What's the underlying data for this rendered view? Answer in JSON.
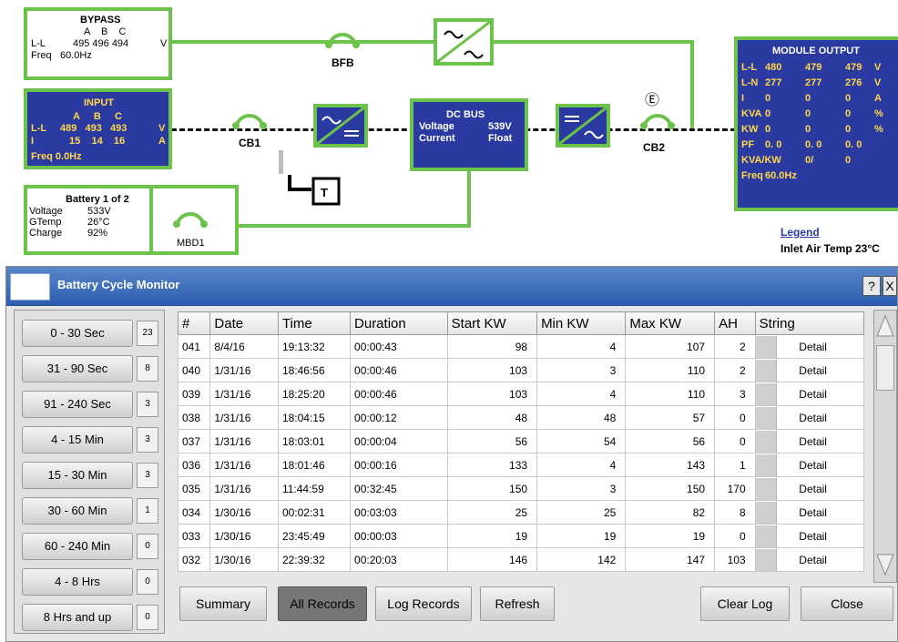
{
  "bypass": {
    "title": "BYPASS",
    "phases": "A    B    C",
    "ll_label": "L-L",
    "ll_values": "495 496 494",
    "ll_unit": "V",
    "freq_label": "Freq",
    "freq_value": "60.0Hz"
  },
  "input": {
    "title": "INPUT",
    "phases": "A     B     C",
    "ll_label": "L-L",
    "ll_values": "489   493   493",
    "ll_unit": "V",
    "i_label": "I",
    "i_values": "15    14    16",
    "i_unit": "A",
    "freq": "Freq 0.0Hz"
  },
  "battery": {
    "title": "Battery 1 of 2",
    "rows": [
      {
        "label": "Voltage",
        "value": "533V"
      },
      {
        "label": "GTemp",
        "value": "26°C"
      },
      {
        "label": "Charge",
        "value": "92%"
      }
    ]
  },
  "dc_bus": {
    "title": "DC BUS",
    "voltage_label": "Voltage",
    "voltage_value": "539V",
    "current_label": "Current",
    "current_value": "Float"
  },
  "breakers": {
    "bfb": "BFB",
    "cb1": "CB1",
    "cb2": "CB2",
    "mbd1": "MBD1",
    "t": "T",
    "e_symbol": "Ⓔ"
  },
  "module_output": {
    "title": "MODULE OUTPUT",
    "rows": [
      {
        "label": "L-L",
        "a": "480",
        "b": "479",
        "c": "479",
        "unit": "V"
      },
      {
        "label": "L-N",
        "a": "277",
        "b": "277",
        "c": "276",
        "unit": "V"
      },
      {
        "label": "I",
        "a": "0",
        "b": "0",
        "c": "0",
        "unit": "A"
      },
      {
        "label": "KVA",
        "a": "0",
        "b": "0",
        "c": "0",
        "unit": "%"
      },
      {
        "label": "KW",
        "a": "0",
        "b": "0",
        "c": "0",
        "unit": "%"
      },
      {
        "label": "PF",
        "a": "0. 0",
        "b": "0. 0",
        "c": "0. 0",
        "unit": ""
      },
      {
        "label": "KVA/KW",
        "a": "",
        "b": "0/",
        "c": "0",
        "unit": ""
      },
      {
        "label": "Freq",
        "a": "60.0Hz",
        "b": "",
        "c": "",
        "unit": ""
      }
    ]
  },
  "legend": {
    "title": "Legend",
    "inlet": "Inlet Air Temp 23°C"
  },
  "dialog": {
    "title": "Battery Cycle Monitor",
    "help_label": "?",
    "close_x": "X",
    "ranges": [
      {
        "label": "0 - 30 Sec",
        "count": "23"
      },
      {
        "label": "31 - 90 Sec",
        "count": "8"
      },
      {
        "label": "91 - 240 Sec",
        "count": "3"
      },
      {
        "label": "4 - 15  Min",
        "count": "3"
      },
      {
        "label": "15 - 30  Min",
        "count": "3"
      },
      {
        "label": "30 - 60 Min",
        "count": "1"
      },
      {
        "label": "60 - 240 Min",
        "count": "0"
      },
      {
        "label": "4 - 8 Hrs",
        "count": "0"
      },
      {
        "label": "8 Hrs and up",
        "count": "0"
      }
    ],
    "columns": [
      "#",
      "Date",
      "Time",
      "Duration",
      "Start KW",
      "Min KW",
      "Max KW",
      "AH",
      "String"
    ],
    "rows": [
      [
        "041",
        "8/4/16",
        "19:13:32",
        "00:00:43",
        "98",
        "4",
        "107",
        "2",
        "Detail"
      ],
      [
        "040",
        "1/31/16",
        "18:46:56",
        "00:00:46",
        "103",
        "3",
        "110",
        "2",
        "Detail"
      ],
      [
        "039",
        "1/31/16",
        "18:25:20",
        "00:00:46",
        "103",
        "4",
        "110",
        "3",
        "Detail"
      ],
      [
        "038",
        "1/31/16",
        "18:04:15",
        "00:00:12",
        "48",
        "48",
        "57",
        "0",
        "Detail"
      ],
      [
        "037",
        "1/31/16",
        "18:03:01",
        "00:00:04",
        "56",
        "54",
        "56",
        "0",
        "Detail"
      ],
      [
        "036",
        "1/31/16",
        "18:01:46",
        "00:00:16",
        "133",
        "4",
        "143",
        "1",
        "Detail"
      ],
      [
        "035",
        "1/31/16",
        "11:44:59",
        "00:32:45",
        "150",
        "3",
        "150",
        "170",
        "Detail"
      ],
      [
        "034",
        "1/30/16",
        "00:02:31",
        "00:03:03",
        "25",
        "25",
        "82",
        "8",
        "Detail"
      ],
      [
        "033",
        "1/30/16",
        "23:45:49",
        "00:00:03",
        "19",
        "19",
        "19",
        "0",
        "Detail"
      ],
      [
        "032",
        "1/30/16",
        "22:39:32",
        "00:20:03",
        "146",
        "142",
        "147",
        "103",
        "Detail"
      ]
    ],
    "buttons": {
      "summary": "Summary",
      "all_records": "All Records",
      "log_records": "Log Records",
      "refresh": "Refresh",
      "clear_log": "Clear Log",
      "close": "Close"
    }
  }
}
